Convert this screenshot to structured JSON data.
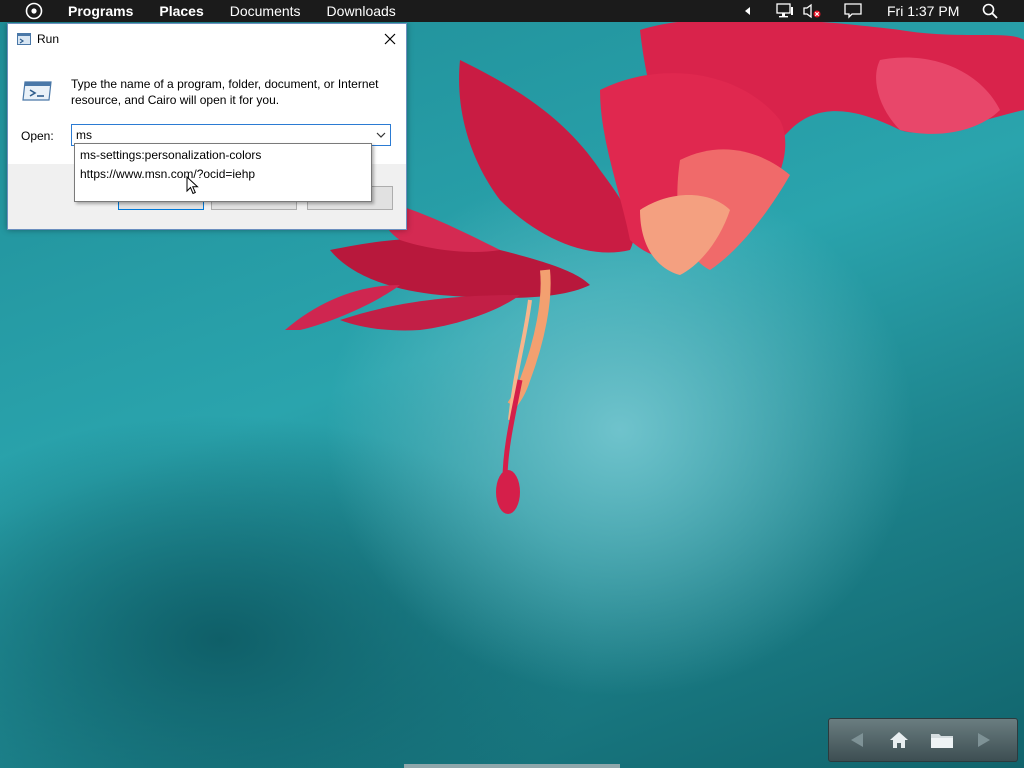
{
  "menubar": {
    "items": [
      "Programs",
      "Places",
      "Documents",
      "Downloads"
    ],
    "clock": "Fri 1:37 PM",
    "icons": [
      "cairo-logo-icon",
      "tray-arrow-icon",
      "network-icon",
      "volume-muted-icon",
      "notification-icon",
      "search-icon"
    ]
  },
  "run_dialog": {
    "title": "Run",
    "description": "Type the name of a program, folder, document, or Internet resource, and Cairo will open it for you.",
    "open_label": "Open:",
    "input_value": "ms",
    "autocomplete": [
      "ms-settings:personalization-colors",
      "https://www.msn.com/?ocid=iehp"
    ]
  },
  "nav_widget": {
    "icons": [
      "back-arrow-icon",
      "home-icon",
      "folder-icon",
      "forward-arrow-icon"
    ]
  },
  "colors": {
    "menubar_bg": "#1b1b1b",
    "dialog_border": "#6b8fbf",
    "input_focus": "#2b7bd3",
    "wallpaper_teal": "#2aa4ad",
    "flower_pink": "#e0284f"
  }
}
